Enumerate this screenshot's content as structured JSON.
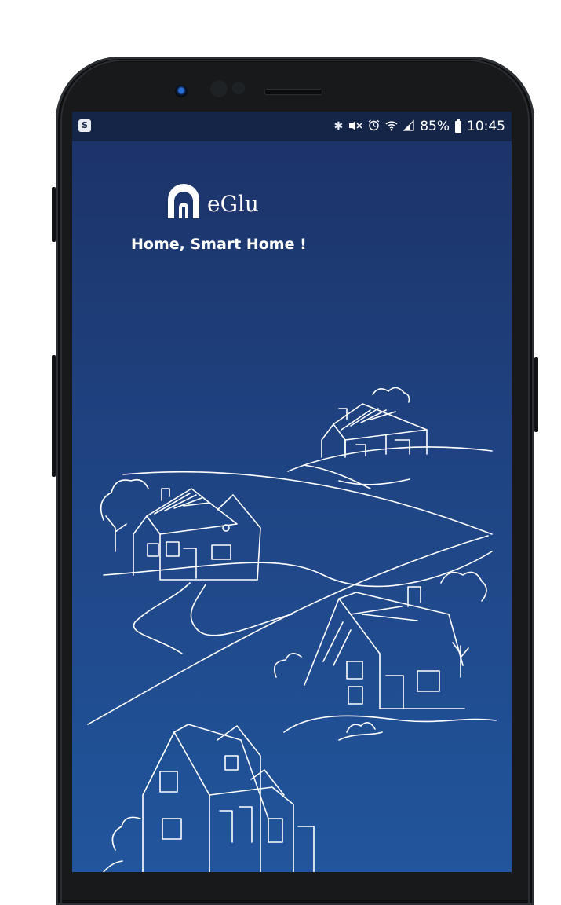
{
  "status_bar": {
    "left_icon": "S",
    "icons": [
      "bluetooth-icon",
      "mute-icon",
      "alarm-icon",
      "wifi-icon",
      "signal-icon"
    ],
    "battery_percent": "85%",
    "time": "10:45"
  },
  "app": {
    "name": "eGlu",
    "tagline": "Home, Smart Home !"
  },
  "colors": {
    "status_bar": "#152548",
    "screen_top": "#1c3266",
    "screen_bottom": "#21559c",
    "line_art": "#ffffff",
    "phone_body": "#17191b"
  }
}
